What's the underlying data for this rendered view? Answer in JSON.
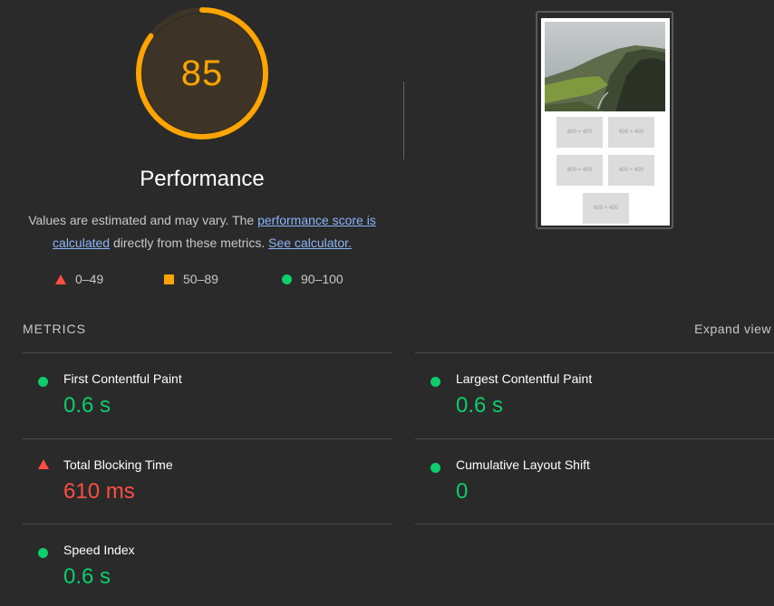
{
  "score": {
    "value": "85",
    "fraction": 0.85,
    "color": "#ffa400"
  },
  "category": {
    "title": "Performance"
  },
  "description": {
    "prefix": "Values are estimated and may vary. The ",
    "link1": "performance score is calculated",
    "middle": " directly from these metrics. ",
    "link2": "See calculator."
  },
  "legend": [
    {
      "icon": "red-triangle-icon",
      "label": "0–49",
      "color": "#ff4e42"
    },
    {
      "icon": "orange-square-icon",
      "label": "50–89",
      "color": "#ffa400"
    },
    {
      "icon": "green-circle-icon",
      "label": "90–100",
      "color": "#0cce6b"
    }
  ],
  "screenshot": {
    "placeholder_label": "600 × 400"
  },
  "metrics": {
    "heading": "METRICS",
    "expand_label": "Expand view",
    "items": [
      {
        "name": "First Contentful Paint",
        "value": "0.6 s",
        "status": "pass"
      },
      {
        "name": "Largest Contentful Paint",
        "value": "0.6 s",
        "status": "pass"
      },
      {
        "name": "Total Blocking Time",
        "value": "610 ms",
        "status": "fail"
      },
      {
        "name": "Cumulative Layout Shift",
        "value": "0",
        "status": "pass"
      },
      {
        "name": "Speed Index",
        "value": "0.6 s",
        "status": "pass"
      }
    ]
  }
}
